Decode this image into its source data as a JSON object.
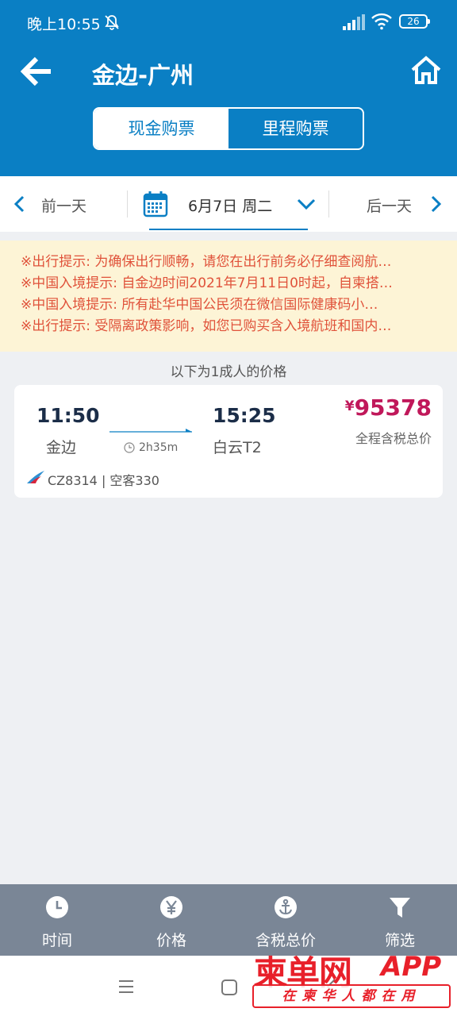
{
  "status_bar": {
    "time": "晚上10:55",
    "battery": "26"
  },
  "header": {
    "title": "金边-广州",
    "tabs": [
      {
        "label": "现金购票",
        "active": true
      },
      {
        "label": "里程购票",
        "active": false
      }
    ],
    "accent_color": "#0a7fc4"
  },
  "date_bar": {
    "prev": "前一天",
    "date": "6月7日 周二",
    "next": "后一天"
  },
  "notices": [
    "※出行提示: 为确保出行顺畅，请您在出行前务必仔细查阅航…",
    "※中国入境提示: 自金边时间2021年7月11日0时起，自柬搭…",
    "※中国入境提示: 所有赴华中国公民须在微信国际健康码小…",
    "※出行提示: 受隔离政策影响，如您已购买含入境航班和国内…"
  ],
  "price_basis": "以下为1成人的价格",
  "flight": {
    "dep_time": "11:50",
    "dep_city": "金边",
    "duration": "2h35m",
    "arr_time": "15:25",
    "arr_city": "白云T2",
    "currency": "¥",
    "price": "95378",
    "price_note": "全程含税总价",
    "flight_info": "CZ8314 | 空客330",
    "price_color": "#c0185a"
  },
  "bottom_tabs": [
    {
      "label": "时间",
      "icon": "clock-icon"
    },
    {
      "label": "价格",
      "icon": "yen-icon"
    },
    {
      "label": "含税总价",
      "icon": "anchor-icon"
    },
    {
      "label": "筛选",
      "icon": "filter-icon"
    }
  ],
  "watermark": {
    "brand": "柬单网",
    "app": "APP",
    "slogan": "在柬华人都在用"
  }
}
